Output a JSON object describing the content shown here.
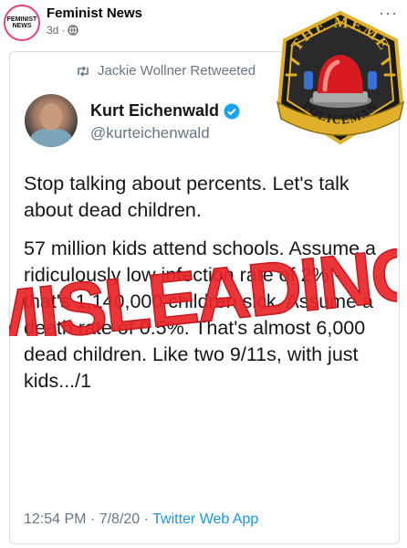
{
  "post": {
    "page_name": "Feminist News",
    "time": "3d",
    "separator": "·",
    "avatar_text": "FEMINIST NEWS",
    "more_icon": "more-dots-icon"
  },
  "tweet": {
    "retweet_label": "Jackie Wollner Retweeted",
    "author_name": "Kurt Eichenwald",
    "author_handle": "@kurteichenwald",
    "paragraphs": [
      "Stop talking about percents. Let's talk about dead children.",
      "57 million kids attend schools. Assume a ridiculously low infection rate of 2% - that's 1,140,000 children sick. Assume a death rate of 0.5%. That's almost 6,000 dead children. Like two 9/11s, with just kids.../1"
    ],
    "timestamp": "12:54 PM · 7/8/20 · ",
    "source": "Twitter Web App"
  },
  "overlay": {
    "stamp_text": "MISLEADING",
    "badge_top": "THE MEME",
    "badge_bottom": "POLICEMAN"
  },
  "colors": {
    "stamp_red": "#e8262a",
    "link_blue": "#1b95e0",
    "verified_blue": "#1da1f2",
    "badge_gold": "#e0b02a"
  }
}
